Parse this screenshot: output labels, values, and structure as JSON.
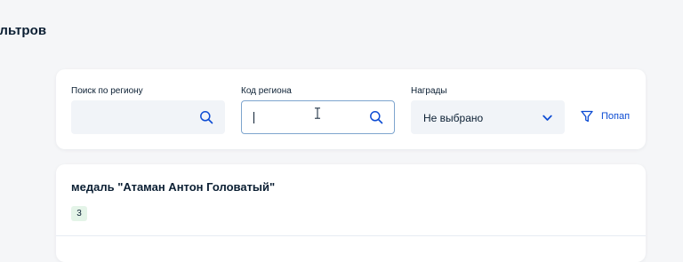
{
  "page": {
    "title": "ильтров"
  },
  "filters": {
    "region_search": {
      "label": "Поиск по региону",
      "value": "",
      "icon": "search-icon"
    },
    "region_code": {
      "label": "Код региона",
      "value": "",
      "icon": "search-icon",
      "focused": true
    },
    "awards": {
      "label": "Награды",
      "selected": "Не выбрано",
      "icon": "chevron-down-icon"
    },
    "popular": {
      "label": "Попап",
      "icon": "funnel-icon"
    }
  },
  "results": [
    {
      "title": "медаль \"Атаман Антон Головатый\"",
      "count": "3"
    }
  ],
  "colors": {
    "background": "#f5f6f8",
    "card": "#ffffff",
    "text": "#0b1f33",
    "accent": "#0d4cd3",
    "input_fill": "#f1f4f8",
    "focus_border": "#7ea5ce",
    "badge_fill": "#e4f4e8"
  }
}
